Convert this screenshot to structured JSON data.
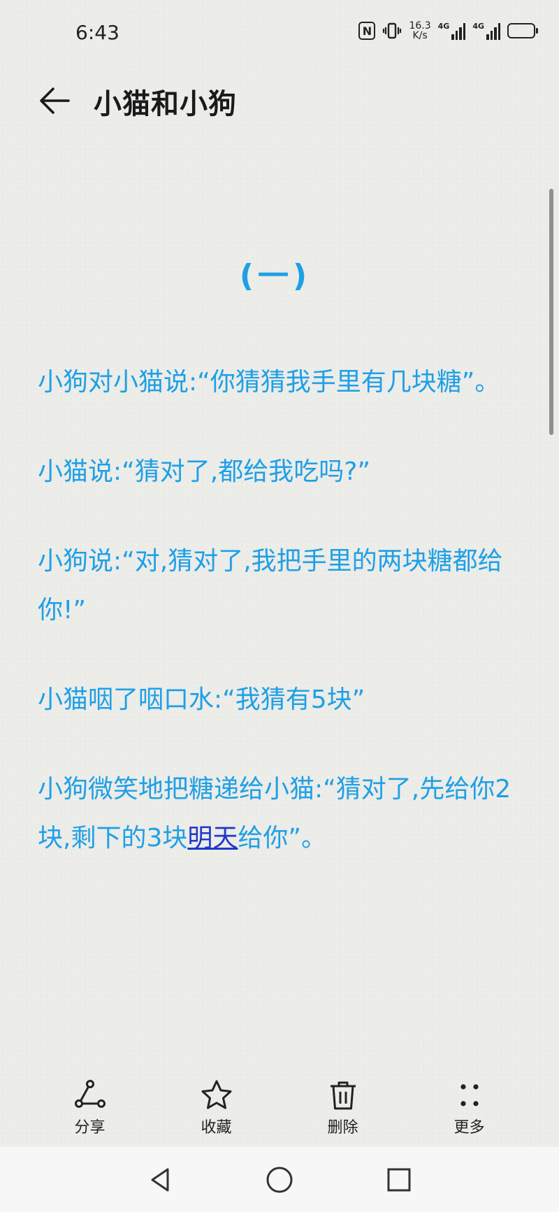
{
  "status_bar": {
    "time": "6:43",
    "network_speed_value": "16.3",
    "network_speed_unit": "K/s",
    "signal1_label": "4G",
    "signal2_label": "4G"
  },
  "header": {
    "title": "小猫和小狗"
  },
  "note": {
    "heading": "(一)",
    "paragraphs": [
      "小狗对小猫说:“你猜猜我手里有几块糖”。",
      "小猫说:“猜对了,都给我吃吗?”",
      "小狗说:“对,猜对了,我把手里的两块糖都给你!”",
      "小猫咽了咽口水:“我猜有5块”"
    ],
    "last_paragraph": {
      "before_link": "小狗微笑地把糖递给小猫:“猜对了,先给你2块,剩下的3块",
      "link": "明天",
      "after_link": "给你”。"
    }
  },
  "toolbar": {
    "share_label": "分享",
    "favorite_label": "收藏",
    "delete_label": "删除",
    "more_label": "更多"
  },
  "colors": {
    "text_accent": "#1ea0e6",
    "link": "#1e39c8"
  }
}
